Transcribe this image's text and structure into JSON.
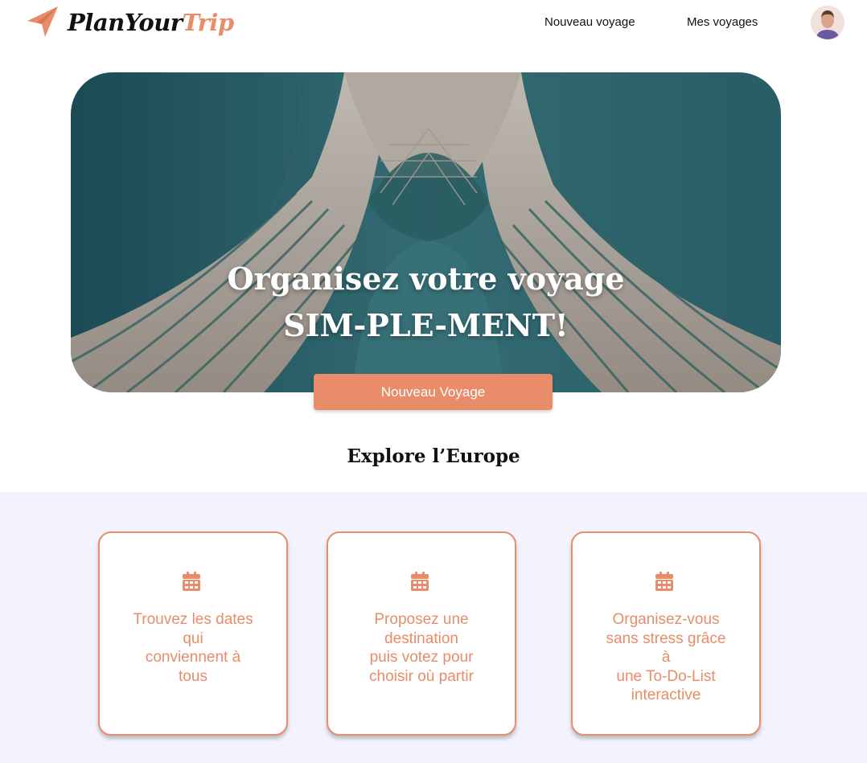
{
  "header": {
    "logo_name": "paper-plane-icon",
    "logo_text_plan": "PlanYour",
    "logo_text_trip": "Trip",
    "nav": [
      {
        "label": "Nouveau voyage"
      },
      {
        "label": "Mes voyages"
      }
    ],
    "avatar_icon": "user-avatar"
  },
  "hero": {
    "title_line1": "Organisez votre voyage",
    "title_line2": "SIM-PLE-MENT!",
    "button_label": "Nouveau Voyage"
  },
  "section": {
    "title": "Explore l’Europe"
  },
  "features": [
    {
      "icon": "calendar-icon",
      "text": "Trouvez les dates\nqui\nconviennent à\ntous"
    },
    {
      "icon": "calendar-icon",
      "text": "Proposez une\ndestination\npuis votez pour\nchoisir où partir"
    },
    {
      "icon": "calendar-icon",
      "text": "Organisez-vous\nsans stress grâce\nà\nune To-Do-List\ninteractive"
    }
  ],
  "colors": {
    "accent": "#e88c6a",
    "band_background": "#f2f3fd",
    "hero_sky": "#2f6b74"
  }
}
